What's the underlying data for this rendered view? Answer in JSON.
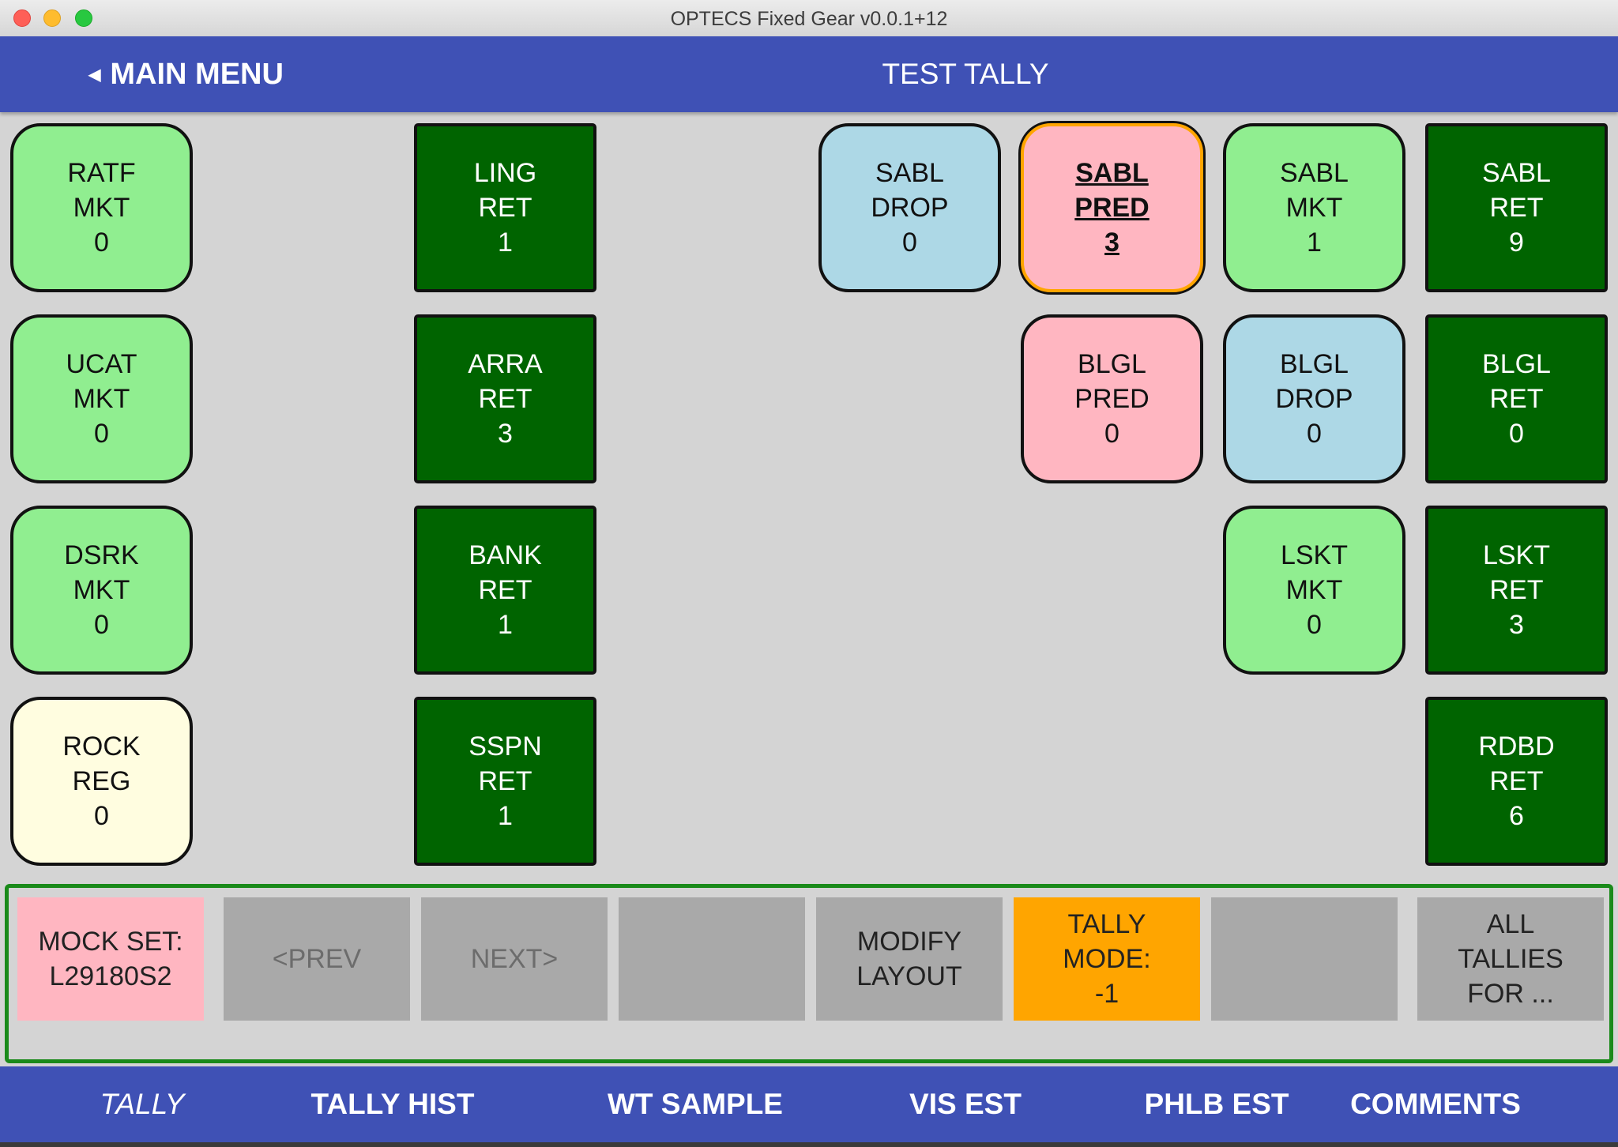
{
  "window": {
    "title": "OPTECS Fixed Gear v0.0.1+12"
  },
  "header": {
    "back_label": "MAIN MENU",
    "title": "TEST TALLY"
  },
  "tiles": [
    {
      "code": "RATF",
      "type": "MKT",
      "count": "0",
      "color": "lightgreen"
    },
    {
      "code": "LING",
      "type": "RET",
      "count": "1",
      "color": "darkgreen"
    },
    {
      "code": "SABL",
      "type": "DROP",
      "count": "0",
      "color": "lightblue"
    },
    {
      "code": "SABL",
      "type": "PRED",
      "count": "3",
      "color": "pink",
      "selected": true
    },
    {
      "code": "SABL",
      "type": "MKT",
      "count": "1",
      "color": "lightgreen"
    },
    {
      "code": "SABL",
      "type": "RET",
      "count": "9",
      "color": "darkgreen"
    },
    {
      "code": "UCAT",
      "type": "MKT",
      "count": "0",
      "color": "lightgreen"
    },
    {
      "code": "ARRA",
      "type": "RET",
      "count": "3",
      "color": "darkgreen"
    },
    {
      "code": "BLGL",
      "type": "PRED",
      "count": "0",
      "color": "pink"
    },
    {
      "code": "BLGL",
      "type": "DROP",
      "count": "0",
      "color": "lightblue"
    },
    {
      "code": "BLGL",
      "type": "RET",
      "count": "0",
      "color": "darkgreen"
    },
    {
      "code": "DSRK",
      "type": "MKT",
      "count": "0",
      "color": "lightgreen"
    },
    {
      "code": "BANK",
      "type": "RET",
      "count": "1",
      "color": "darkgreen"
    },
    {
      "code": "LSKT",
      "type": "MKT",
      "count": "0",
      "color": "lightgreen"
    },
    {
      "code": "LSKT",
      "type": "RET",
      "count": "3",
      "color": "darkgreen"
    },
    {
      "code": "ROCK",
      "type": "REG",
      "count": "0",
      "color": "cream"
    },
    {
      "code": "SSPN",
      "type": "RET",
      "count": "1",
      "color": "darkgreen"
    },
    {
      "code": "RDBD",
      "type": "RET",
      "count": "6",
      "color": "darkgreen"
    }
  ],
  "controls": {
    "mock_set": {
      "line1": "MOCK SET:",
      "line2": "L29180S2"
    },
    "prev": "<PREV",
    "next": "NEXT>",
    "modify_layout": {
      "line1": "MODIFY",
      "line2": "LAYOUT"
    },
    "tally_mode": {
      "line1": "TALLY",
      "line2": "MODE:",
      "line3": "-1"
    },
    "all_tallies": {
      "line1": "ALL",
      "line2": "TALLIES",
      "line3": "FOR ..."
    }
  },
  "bottom_nav": {
    "tabs": [
      {
        "label": "TALLY",
        "active": true
      },
      {
        "label": "TALLY HIST"
      },
      {
        "label": "WT SAMPLE"
      },
      {
        "label": "VIS EST"
      },
      {
        "label": "PHLB EST"
      },
      {
        "label": "COMMENTS"
      }
    ]
  },
  "colors": {
    "header_bg": "#3f51b5",
    "light_green": "#90ee90",
    "dark_green": "#006400",
    "light_blue": "#add8e6",
    "pink": "#ffb6c1",
    "cream": "#fffde0",
    "orange": "#ffa500",
    "panel_border": "#1a8a1a",
    "disabled_gray": "#a9a9a9"
  }
}
